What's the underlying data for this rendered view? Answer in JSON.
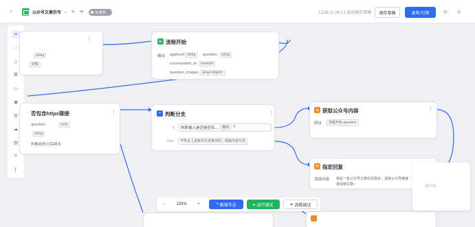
{
  "topbar": {
    "app_title": "公众号文章仿写",
    "status_pill": "未发布",
    "autosave": "12/26 11:06:13 自动保存草稿",
    "save_label": "保存草稿",
    "publish_label": "发布/引用",
    "colors": {
      "accent": "#2f6bef",
      "brand": "#2fb86a"
    }
  },
  "nodes": {
    "left_top": {
      "tag1": "string",
      "tag2": "对象"
    },
    "start": {
      "title": "流程开始",
      "output_label": "输出",
      "var1": "appkeyd",
      "var1_type": "string",
      "var2": "question",
      "var2_type": "string",
      "var3": "conversation_id",
      "var3_type": "boolean",
      "var4": "question_images",
      "var4_type": "array<object>"
    },
    "left_mid": {
      "title": "否包含https链接",
      "var": "question",
      "var_op": "conti",
      "tag": "string",
      "hint": "判断前执行后续步"
    },
    "branch": {
      "title": "判断分支",
      "if_label": "if",
      "cond_text": "判断输入是否是否有...",
      "cond_tag": "输出",
      "cond_suffix": "?",
      "else_label": "else",
      "else_text": "不符合上述条件分支条件时，获取内容分支"
    },
    "fetch": {
      "title": "获取公众号内容",
      "input_label": "网址",
      "input_value": "流程开始-question"
    },
    "reply": {
      "title": "指定回复",
      "label": "消息内容",
      "text1": "我是一名公众号文章仿写助手，请将公众号链接",
      "text2": "发给我文章~"
    }
  },
  "bottombar": {
    "zoom": "100%",
    "minus": "−",
    "plus": "+",
    "add_node": "新增节点",
    "run_test": "运行测试",
    "debug": "流程调试"
  },
  "popover": {
    "text": "运行中..."
  }
}
